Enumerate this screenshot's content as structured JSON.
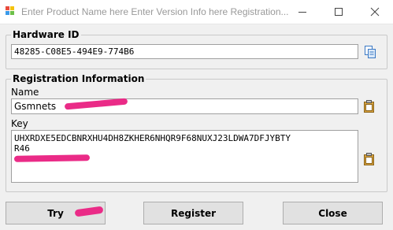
{
  "window": {
    "title": "Enter Product Name here Enter Version Info here Registration...",
    "controls": [
      "minimize-icon",
      "maximize-icon",
      "close-icon"
    ]
  },
  "hardware": {
    "legend": "Hardware ID",
    "value": "48285-C08E5-494E9-774B6",
    "copy_icon": "copy-icon"
  },
  "registration": {
    "legend": "Registration Information",
    "name_label": "Name",
    "name_value": "Gsmnets",
    "key_label": "Key",
    "key_lines": [
      "UHXRDXE5EDCBNRXHU4DH8ZKHER6NHQR9F68NUXJ23LDWA7DFJYBTY",
      "R46"
    ],
    "paste_icon": "clipboard-icon"
  },
  "buttons": {
    "try": "Try",
    "register": "Register",
    "close": "Close"
  },
  "colors": {
    "redaction": "#ea2b87",
    "window_bg": "#f0f0f0",
    "button_bg": "#e1e1e1"
  }
}
